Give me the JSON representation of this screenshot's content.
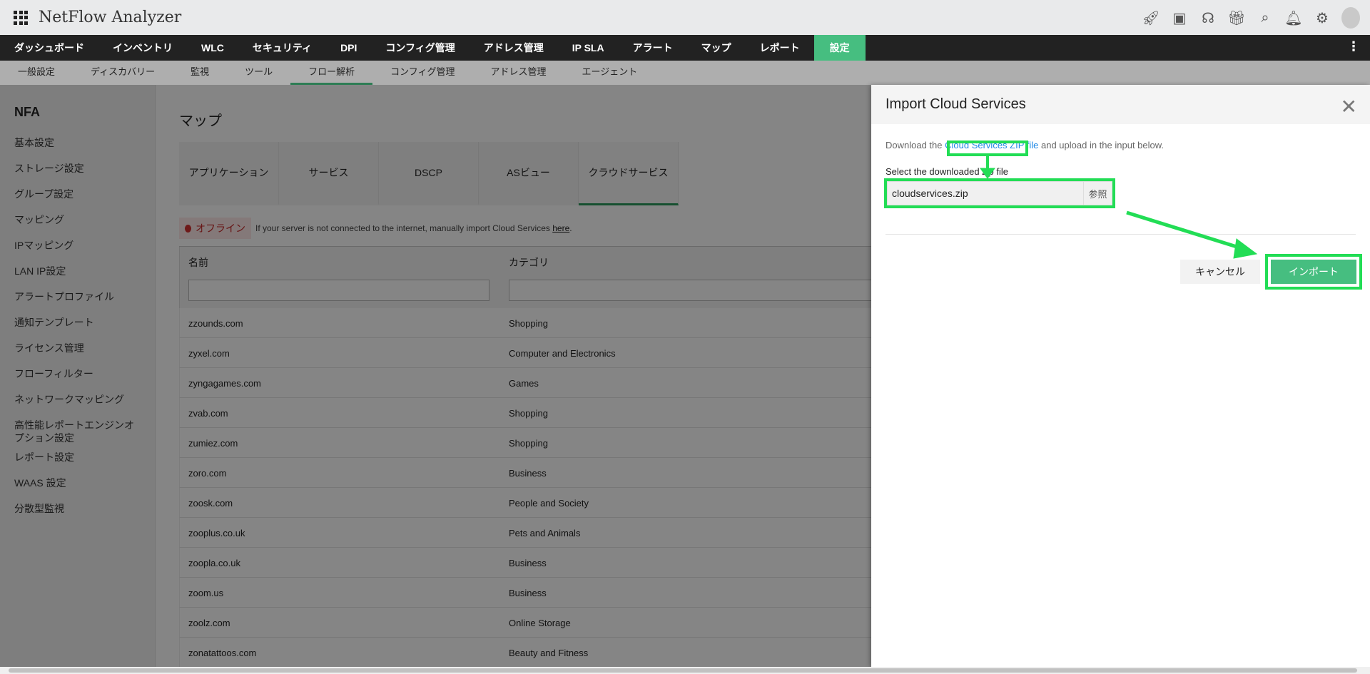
{
  "app": {
    "title": "NetFlow Analyzer",
    "icons": [
      "rocket-icon",
      "presentation-icon",
      "headset-icon",
      "gift-icon",
      "search-icon",
      "bell-icon",
      "gear-icon",
      "avatar"
    ]
  },
  "mainnav": [
    "ダッシュボード",
    "インベントリ",
    "WLC",
    "セキュリティ",
    "DPI",
    "コンフィグ管理",
    "アドレス管理",
    "IP SLA",
    "アラート",
    "マップ",
    "レポート",
    "設定"
  ],
  "subnav": [
    "一般設定",
    "ディスカバリー",
    "監視",
    "ツール",
    "フロー解析",
    "コンフィグ管理",
    "アドレス管理",
    "エージェント"
  ],
  "sidebar": {
    "title": "NFA",
    "items": [
      "基本設定",
      "ストレージ設定",
      "グループ設定",
      "マッピング",
      "IPマッピング",
      "LAN IP設定",
      "アラートプロファイル",
      "通知テンプレート",
      "ライセンス管理",
      "フローフィルター",
      "ネットワークマッピング",
      "高性能レポートエンジンオプション設定",
      "レポート設定",
      "WAAS 設定",
      "分散型監視"
    ]
  },
  "page": {
    "title": "マップ",
    "tabs": [
      "アプリケーション",
      "サービス",
      "DSCP",
      "ASビュー",
      "クラウドサービス"
    ],
    "offline": {
      "badge": "オフライン",
      "message": "If your server is not connected to the internet, manually import Cloud Services ",
      "link": "here",
      "end": "."
    },
    "table": {
      "headers": [
        "名前",
        "カテゴリ"
      ],
      "rows": [
        [
          "zzounds.com",
          "Shopping"
        ],
        [
          "zyxel.com",
          "Computer and Electronics"
        ],
        [
          "zyngagames.com",
          "Games"
        ],
        [
          "zvab.com",
          "Shopping"
        ],
        [
          "zumiez.com",
          "Shopping"
        ],
        [
          "zoro.com",
          "Business"
        ],
        [
          "zoosk.com",
          "People and Society"
        ],
        [
          "zooplus.co.uk",
          "Pets and Animals"
        ],
        [
          "zoopla.co.uk",
          "Business"
        ],
        [
          "zoom.us",
          "Business"
        ],
        [
          "zoolz.com",
          "Online Storage"
        ],
        [
          "zonatattoos.com",
          "Beauty and Fitness"
        ]
      ]
    }
  },
  "dialog": {
    "title": "Import Cloud Services",
    "text_pre": "Download the ",
    "link": "Cloud Services ZIP file",
    "text_post": " and upload in the input below.",
    "label": "Select the downloaded zip file",
    "file_value": "cloudservices.zip",
    "browse": "参照",
    "cancel": "キャンセル",
    "import": "インポート"
  },
  "colors": {
    "accent": "#46be80",
    "highlight": "#22dd55",
    "nav": "#222222"
  }
}
